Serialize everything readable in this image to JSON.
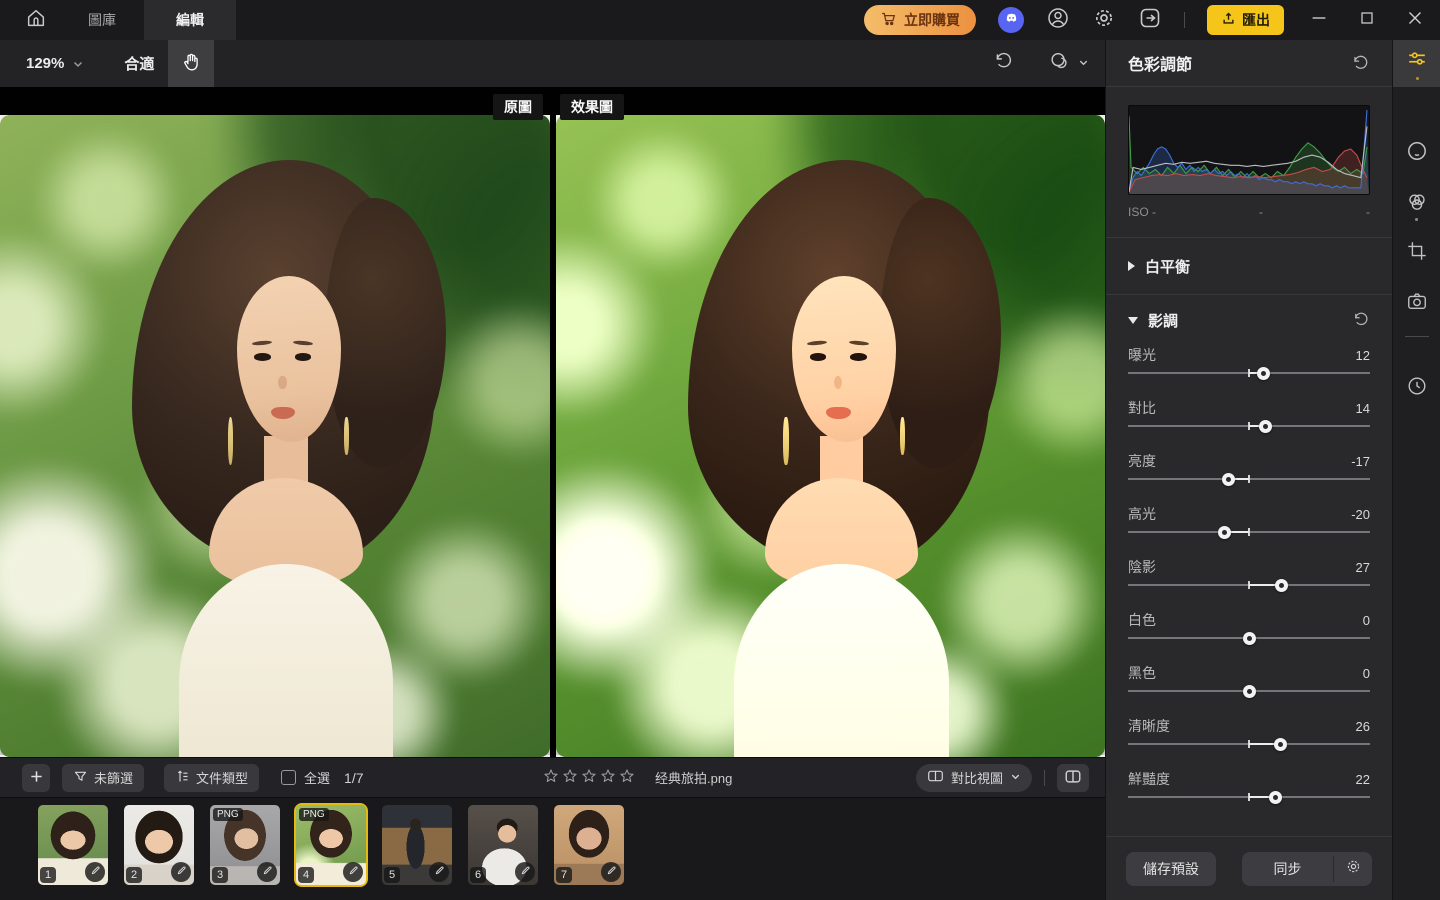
{
  "topbar": {
    "tabs": [
      {
        "id": "gallery",
        "label": "圖庫"
      },
      {
        "id": "edit",
        "label": "編輯"
      }
    ],
    "buy_label": "立即購買",
    "export_label": "匯出"
  },
  "toolbar": {
    "zoom_level": "129%",
    "fit_label": "合適"
  },
  "canvas": {
    "original_label": "原圖",
    "effect_label": "效果圖"
  },
  "panel": {
    "title": "色彩調節",
    "iso_label": "ISO -",
    "meta_dash_1": "-",
    "meta_dash_2": "-",
    "white_balance_label": "白平衡",
    "tone_label": "影調",
    "sliders": [
      {
        "label": "曝光",
        "value": 12
      },
      {
        "label": "對比",
        "value": 14
      },
      {
        "label": "亮度",
        "value": -17
      },
      {
        "label": "高光",
        "value": -20
      },
      {
        "label": "陰影",
        "value": 27
      },
      {
        "label": "白色",
        "value": 0
      },
      {
        "label": "黑色",
        "value": 0
      },
      {
        "label": "清晰度",
        "value": 26
      },
      {
        "label": "鮮豔度",
        "value": 22
      }
    ],
    "save_preset_label": "儲存預設",
    "sync_label": "同步"
  },
  "bottombar": {
    "filter_label": "未篩選",
    "filetype_label": "文件類型",
    "select_all_label": "全選",
    "counter": "1/7",
    "star_count": 5,
    "filename": "经典旅拍.png",
    "compare_view_label": "對比視圖"
  },
  "filmstrip": {
    "items": [
      {
        "number": "1",
        "badge": "",
        "selected": false
      },
      {
        "number": "2",
        "badge": "",
        "selected": false
      },
      {
        "number": "3",
        "badge": "PNG",
        "selected": false
      },
      {
        "number": "4",
        "badge": "PNG",
        "selected": true
      },
      {
        "number": "5",
        "badge": "",
        "selected": false
      },
      {
        "number": "6",
        "badge": "",
        "selected": false
      },
      {
        "number": "7",
        "badge": "",
        "selected": false
      }
    ]
  },
  "colors": {
    "accent_yellow": "#f6c51a",
    "buy_gradient_start": "#f5bd6a",
    "buy_gradient_end": "#ec9140",
    "discord_blue": "#5865f2",
    "selected_thumb_border": "#e5b911"
  }
}
